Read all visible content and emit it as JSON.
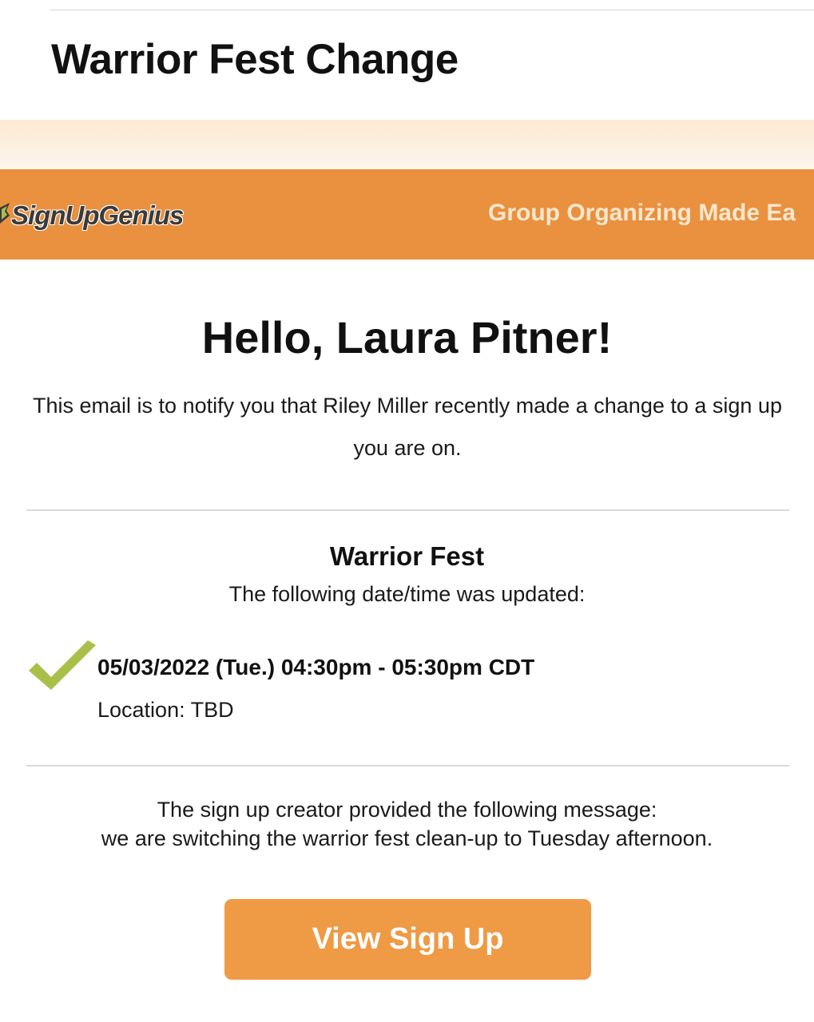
{
  "email": {
    "subject": "Warrior Fest Change"
  },
  "brand": {
    "logo_text": "SignUpGenius",
    "tagline": "Group Organizing Made Ea",
    "bar_color": "#e9913f",
    "check_color": "#a8c04a"
  },
  "greeting": "Hello, Laura Pitner!",
  "intro": "This email is to notify you that Riley Miller recently made a change to a sign up you are on.",
  "event": {
    "title": "Warrior Fest",
    "subtitle": "The following date/time was updated:",
    "slot_time": "05/03/2022 (Tue.) 04:30pm - 05:30pm CDT",
    "location": "Location: TBD"
  },
  "message": {
    "intro": "The sign up creator provided the following message:",
    "body": "we are switching the warrior fest clean-up to Tuesday afternoon."
  },
  "cta": {
    "label": "View Sign Up"
  },
  "icons": [
    "logo-mark-icon",
    "checkmark-icon"
  ]
}
